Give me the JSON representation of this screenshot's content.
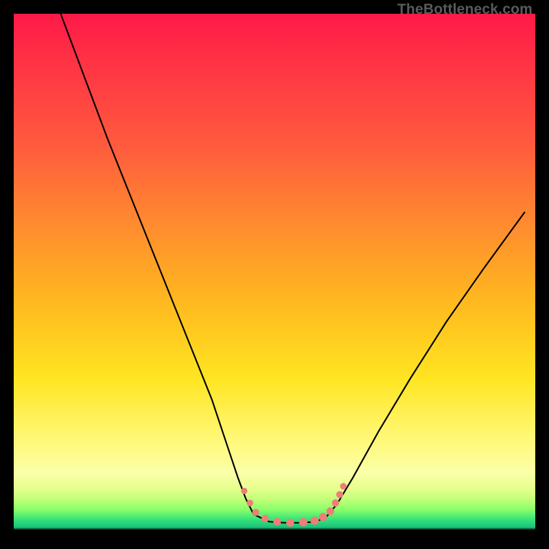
{
  "watermark": "TheBottleneck.com",
  "chart_data": {
    "type": "line",
    "title": "",
    "xlabel": "",
    "ylabel": "",
    "xlim": [
      0,
      100
    ],
    "ylim": [
      0,
      100
    ],
    "note": "Axes are unlabeled; x and y are normalized 0-100 from pixel positions. Lower y = bottom of plot (trough).",
    "series": [
      {
        "name": "left-branch",
        "x": [
          9,
          12,
          15,
          18,
          22,
          26,
          30,
          34,
          38,
          41,
          43,
          44.5,
          46
        ],
        "y": [
          100,
          92,
          84,
          76,
          66,
          56,
          46,
          36,
          26,
          17,
          11,
          7,
          4
        ]
      },
      {
        "name": "trough",
        "x": [
          46,
          49,
          52,
          55,
          58,
          60
        ],
        "y": [
          4,
          2.6,
          2.4,
          2.4,
          2.6,
          3.6
        ]
      },
      {
        "name": "right-branch",
        "x": [
          60,
          62,
          65,
          70,
          76,
          83,
          90,
          98
        ],
        "y": [
          3.6,
          6,
          11,
          20,
          30,
          41,
          51,
          62
        ]
      }
    ],
    "markers": {
      "name": "trough-markers",
      "points": [
        {
          "x": 44.2,
          "y": 8.5
        },
        {
          "x": 45.3,
          "y": 6.2
        },
        {
          "x": 46.4,
          "y": 4.4
        },
        {
          "x": 48.2,
          "y": 3.2
        },
        {
          "x": 50.5,
          "y": 2.6
        },
        {
          "x": 53.0,
          "y": 2.4
        },
        {
          "x": 55.5,
          "y": 2.5
        },
        {
          "x": 57.7,
          "y": 2.8
        },
        {
          "x": 59.3,
          "y": 3.5
        },
        {
          "x": 60.7,
          "y": 4.6
        },
        {
          "x": 61.7,
          "y": 6.2
        },
        {
          "x": 62.5,
          "y": 7.8
        },
        {
          "x": 63.2,
          "y": 9.4
        }
      ]
    }
  }
}
